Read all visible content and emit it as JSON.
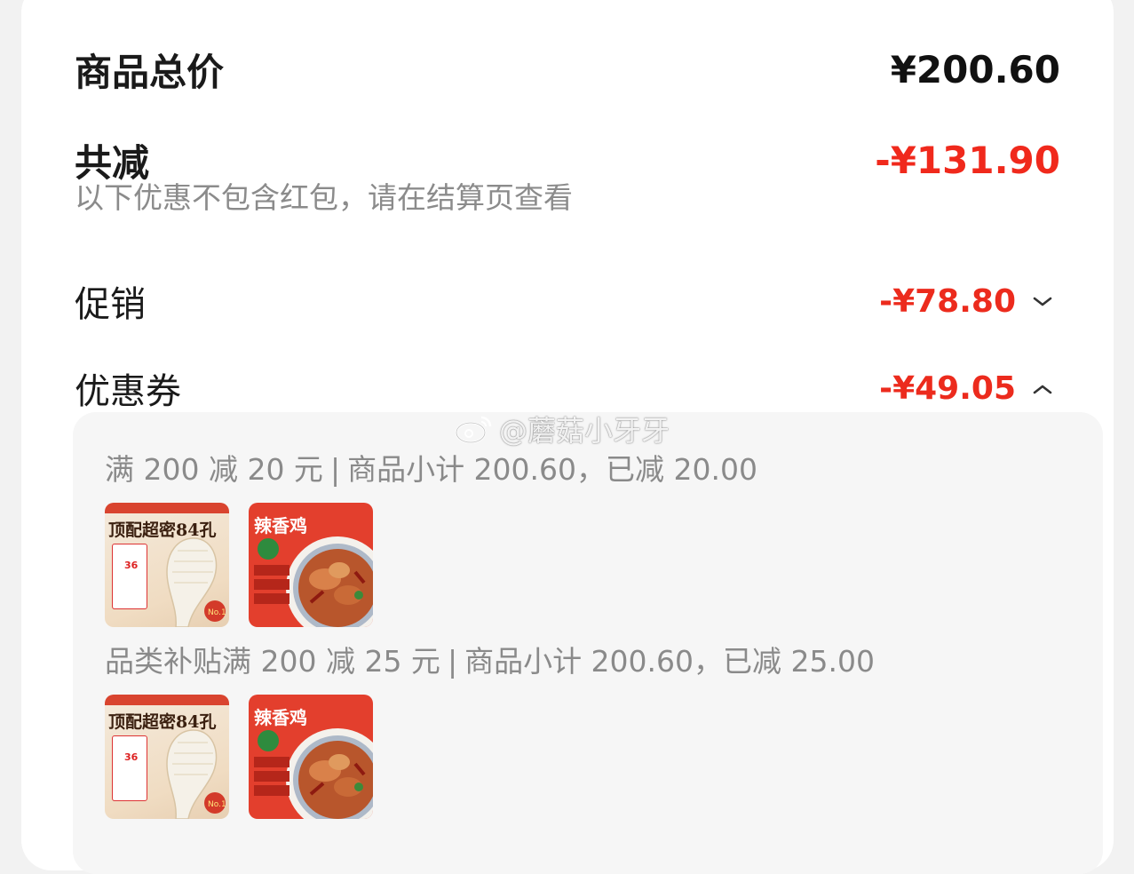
{
  "summary": {
    "total_label": "商品总价",
    "total_value": "¥200.60",
    "discount_label": "共减",
    "discount_value": "-¥131.90",
    "note": "以下优惠不包含红包，请在结算页查看"
  },
  "lines": [
    {
      "label": "促销",
      "value": "-¥78.80",
      "expanded": false,
      "chevron": "chevron-down-icon"
    },
    {
      "label": "优惠券",
      "value": "-¥49.05",
      "expanded": true,
      "chevron": "chevron-up-icon"
    }
  ],
  "coupons": [
    {
      "name": "满 200 减 20 元",
      "detail": "商品小计 200.60，已减 20.00",
      "items": [
        {
          "title": "顶配超密84孔",
          "badge": "36",
          "kind": "toothbrush"
        },
        {
          "title": "辣香鸡",
          "kind": "spicy-chicken"
        }
      ]
    },
    {
      "name": "品类补贴满 200 减 25 元",
      "detail": "商品小计 200.60，已减 25.00",
      "items": [
        {
          "title": "顶配超密84孔",
          "badge": "36",
          "kind": "toothbrush"
        },
        {
          "title": "辣香鸡",
          "kind": "spicy-chicken"
        }
      ]
    }
  ],
  "watermark": "@蘑菇小牙牙",
  "colors": {
    "discount_red": "#f0291c",
    "panel_bg": "#f6f6f6",
    "note_gray": "#8b8b8b"
  }
}
